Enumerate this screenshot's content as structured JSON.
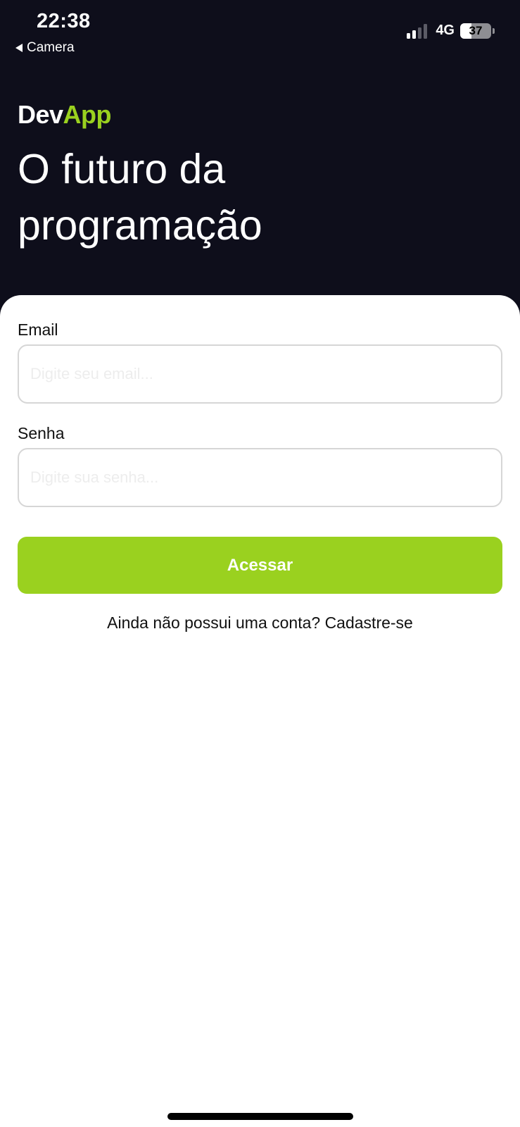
{
  "status_bar": {
    "time": "22:38",
    "back_label": "Camera",
    "network": "4G",
    "battery_percent": "37",
    "battery_level": 0.37,
    "signal_bars_active": 2,
    "signal_bars_total": 4
  },
  "header": {
    "brand_part1": "Dev",
    "brand_part2": "App",
    "headline_line1": "O futuro da",
    "headline_line2": "programação"
  },
  "form": {
    "email_label": "Email",
    "email_placeholder": "Digite seu email...",
    "password_label": "Senha",
    "password_placeholder": "Digite sua senha...",
    "submit_label": "Acessar",
    "signup_text": "Ainda não possui uma conta? Cadastre-se"
  },
  "colors": {
    "header_bg": "#0e0e1b",
    "accent": "#9ad11f"
  }
}
